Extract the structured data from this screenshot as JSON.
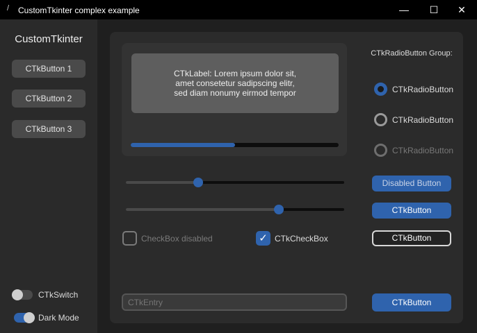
{
  "window": {
    "title": "CustomTkinter complex example",
    "minimize": "—",
    "maximize": "☐",
    "close": "✕"
  },
  "sidebar": {
    "title": "CustomTkinter",
    "buttons": [
      "CTkButton 1",
      "CTkButton 2",
      "CTkButton 3"
    ],
    "switch_label": "CTkSwitch",
    "switch_on": false,
    "dark_mode_label": "Dark Mode",
    "dark_mode_on": true
  },
  "main": {
    "label_text": "CTkLabel: Lorem ipsum dolor sit,\namet consetetur sadipscing elitr,\nsed diam nonumy eirmod tempor",
    "progress": 0.5,
    "radio_group_label": "CTkRadioButton Group:",
    "radios": [
      {
        "label": "CTkRadioButton",
        "selected": true
      },
      {
        "label": "CTkRadioButton",
        "selected": false
      },
      {
        "label": "CTkRadioButton",
        "selected": false,
        "disabled": true
      }
    ],
    "slider1": 0.33,
    "slider2": 0.7,
    "disabled_button": "Disabled Button",
    "button": "CTkButton",
    "outlined_button": "CTkButton",
    "bottom_button": "CTkButton",
    "checkbox_disabled": "CheckBox disabled",
    "checkbox": "CTkCheckBox",
    "entry_placeholder": "CTkEntry"
  },
  "colors": {
    "accent": "#2f63ad"
  }
}
